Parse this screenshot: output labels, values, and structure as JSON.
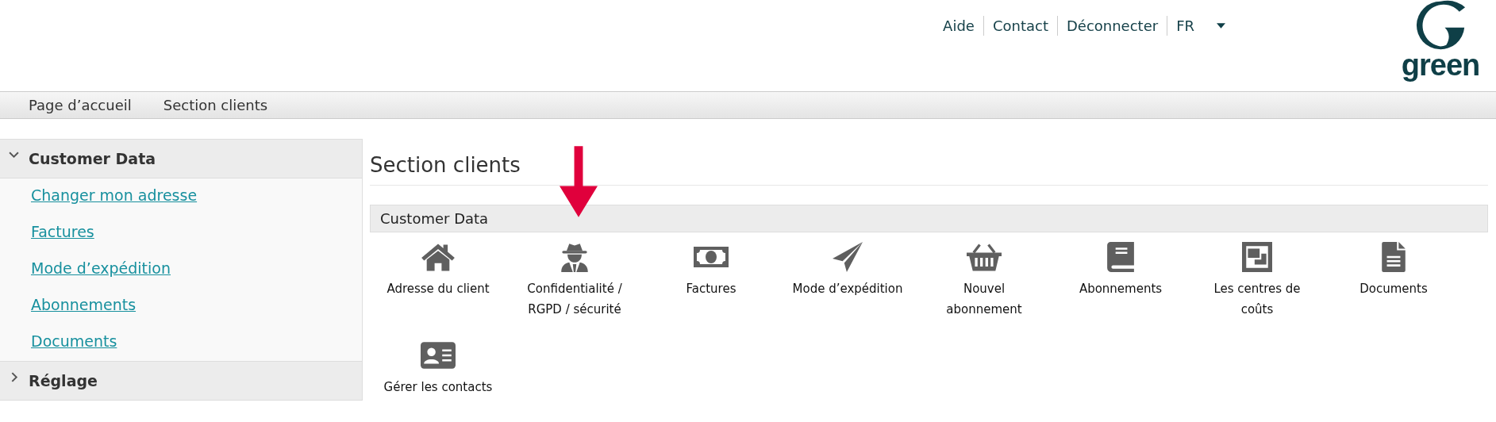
{
  "header": {
    "links": [
      "Aide",
      "Contact",
      "Déconnecter"
    ],
    "language": {
      "value": "FR",
      "expanded": false
    },
    "logo": "green"
  },
  "breadcrumb": [
    "Page d’accueil",
    "Section clients"
  ],
  "sidebar": {
    "groups": [
      {
        "label": "Customer Data",
        "expanded": true,
        "children": [
          "Changer mon adresse",
          "Factures",
          "Mode d’expédition",
          "Abonnements",
          "Documents"
        ]
      },
      {
        "label": "Réglage",
        "expanded": false
      }
    ]
  },
  "main": {
    "title": "Section clients",
    "section": "Customer Data",
    "tiles": [
      "Adresse du client",
      "Confidentialité / RGPD / sécurité",
      "Factures",
      "Mode d’expédition",
      "Nouvel abonnement",
      "Abonnements",
      "Les centres de coûts",
      "Documents",
      "Gérer les contacts"
    ]
  }
}
